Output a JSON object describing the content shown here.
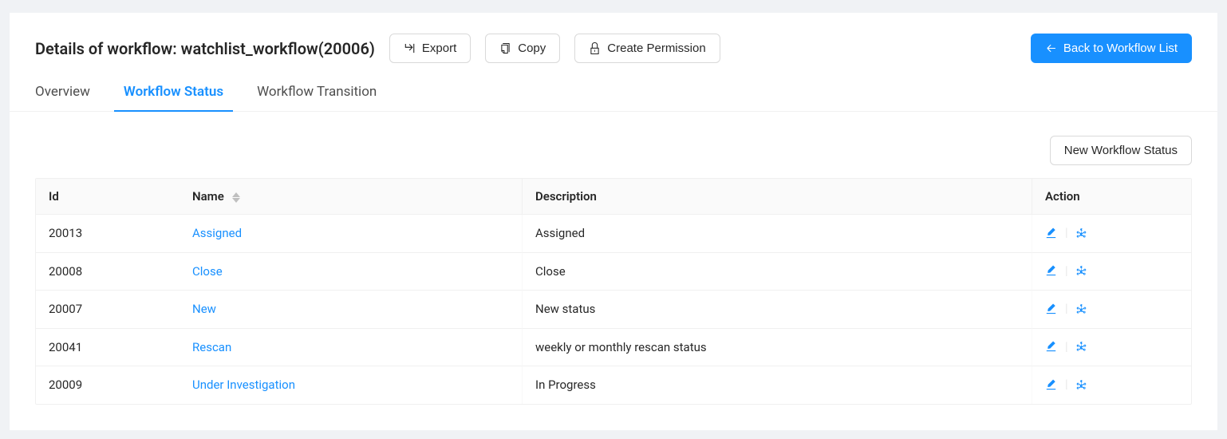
{
  "header": {
    "title": "Details of workflow: watchlist_workflow(20006)",
    "export_label": "Export",
    "copy_label": "Copy",
    "create_permission_label": "Create Permission",
    "back_label": "Back to Workflow List"
  },
  "tabs": {
    "overview": "Overview",
    "workflow_status": "Workflow Status",
    "workflow_transition": "Workflow Transition"
  },
  "toolbar": {
    "new_status_label": "New Workflow Status"
  },
  "table": {
    "headers": {
      "id": "Id",
      "name": "Name",
      "description": "Description",
      "action": "Action"
    },
    "rows": [
      {
        "id": "20013",
        "name": "Assigned",
        "description": "Assigned"
      },
      {
        "id": "20008",
        "name": "Close",
        "description": "Close"
      },
      {
        "id": "20007",
        "name": "New",
        "description": "New status"
      },
      {
        "id": "20041",
        "name": "Rescan",
        "description": "weekly or monthly rescan status"
      },
      {
        "id": "20009",
        "name": "Under Investigation",
        "description": "In Progress"
      }
    ]
  }
}
